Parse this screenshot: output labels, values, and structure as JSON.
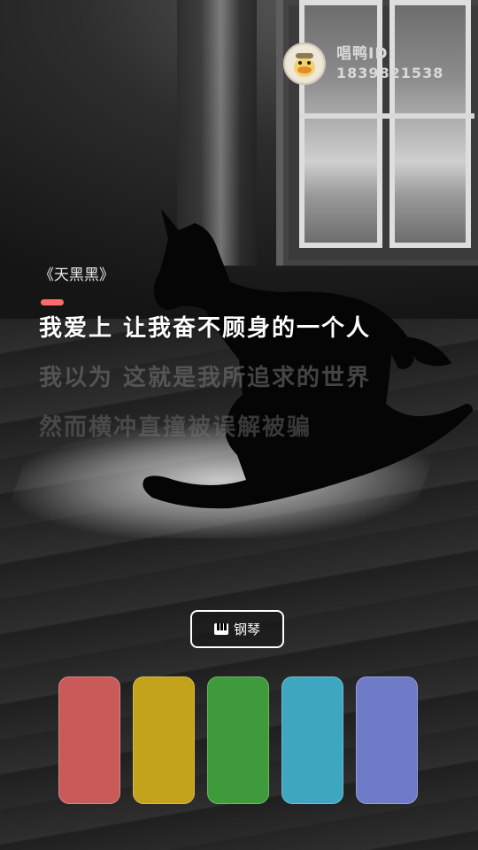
{
  "header": {
    "user_id_label": "唱鸭ID:",
    "user_id_value": "1839821538",
    "avatar_icon": "duck-avatar-icon"
  },
  "song": {
    "title": "《天黑黑》"
  },
  "lyrics": {
    "current": "我爱上  让我奋不顾身的一个人",
    "next_1": "我以为  这就是我所追求的世界",
    "next_2": "然而横冲直撞被误解被骗"
  },
  "instrument": {
    "label": "钢琴",
    "icon": "piano-icon"
  },
  "keys": [
    {
      "color": "#c85a5a"
    },
    {
      "color": "#c3a21c"
    },
    {
      "color": "#3f9a3c"
    },
    {
      "color": "#3ea7bf"
    },
    {
      "color": "#6f7bc7"
    }
  ],
  "colors": {
    "progress_accent": "#ff6b6b"
  }
}
